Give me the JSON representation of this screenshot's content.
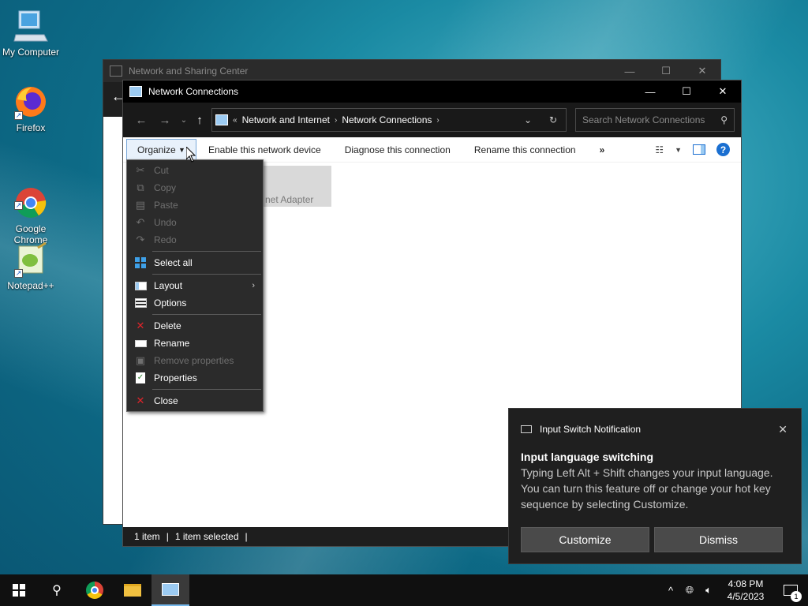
{
  "desktop": {
    "icons": [
      {
        "label": "My Computer"
      },
      {
        "label": "Firefox"
      },
      {
        "label": "Google\nChrome"
      },
      {
        "label": "Notepad++"
      }
    ]
  },
  "bg_window": {
    "title": "Network and Sharing Center"
  },
  "window": {
    "title": "Network Connections",
    "breadcrumb": [
      "Network and Internet",
      "Network Connections"
    ],
    "search_placeholder": "Search Network Connections",
    "commands": {
      "organize": "Organize",
      "enable": "Enable this network device",
      "diagnose": "Diagnose this connection",
      "rename": "Rename this connection",
      "more": "»"
    },
    "item_label": "net Adapter",
    "status": {
      "count": "1 item",
      "selected": "1 item selected"
    }
  },
  "menu": {
    "cut": "Cut",
    "copy": "Copy",
    "paste": "Paste",
    "undo": "Undo",
    "redo": "Redo",
    "select_all": "Select all",
    "layout": "Layout",
    "options": "Options",
    "delete": "Delete",
    "rename": "Rename",
    "remove_properties": "Remove properties",
    "properties": "Properties",
    "close": "Close"
  },
  "toast": {
    "app": "Input Switch Notification",
    "title": "Input language switching",
    "body": "Typing Left Alt + Shift changes your input language. You can turn this feature off or change your hot key sequence by selecting Customize.",
    "customize": "Customize",
    "dismiss": "Dismiss"
  },
  "taskbar": {
    "time": "4:08 PM",
    "date": "4/5/2023",
    "notification_count": "1"
  },
  "colors": {
    "accent": "#1a6fd1",
    "delete_red": "#e0242a"
  }
}
